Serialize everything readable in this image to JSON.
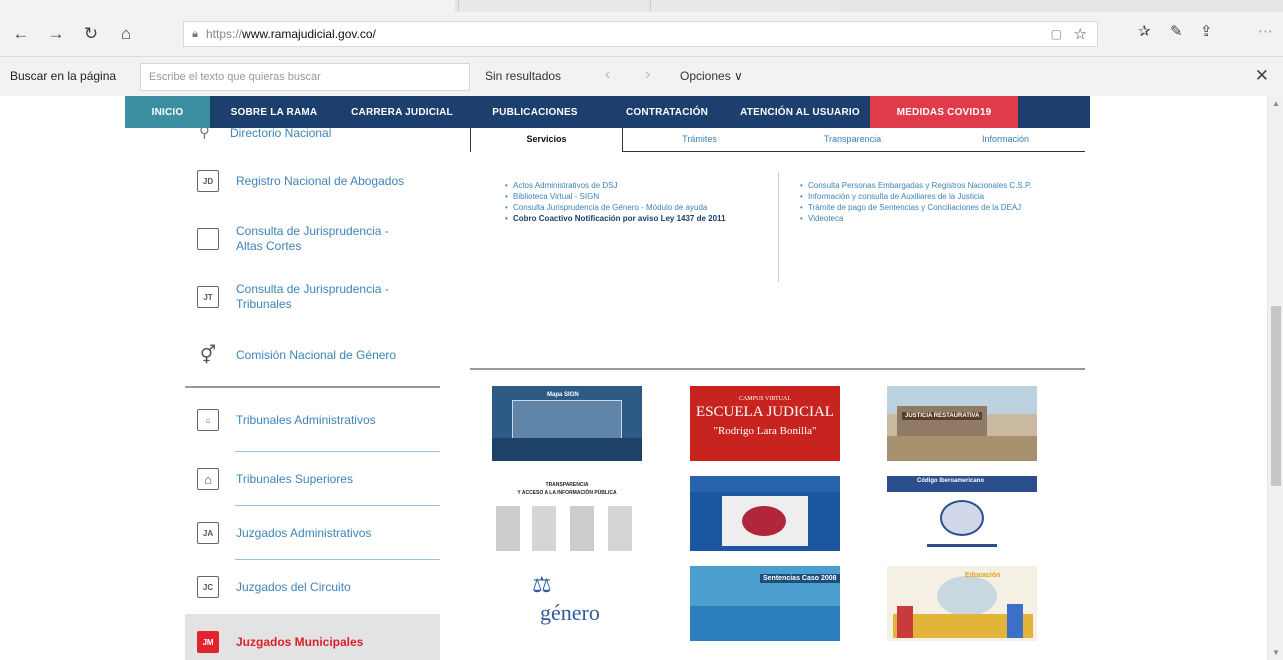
{
  "browser": {
    "url_proto": "https://",
    "url_host": "www.ramajudicial.gov.co/",
    "find_label": "Buscar en la página",
    "find_placeholder": "Escribe el texto que quieras buscar",
    "find_results": "Sin resultados",
    "find_options": "Opciones ∨"
  },
  "nav": {
    "items": [
      "INICIO",
      "SOBRE LA RAMA",
      "CARRERA JUDICIAL",
      "PUBLICACIONES",
      "CONTRATACIÓN",
      "ATENCIÓN AL USUARIO",
      "MEDIDAS COVID19"
    ]
  },
  "subtabs": [
    "Servicios",
    "Trámites",
    "Transparencia",
    "Información"
  ],
  "leftmenu": {
    "partial": "Directorio Nacional",
    "items": [
      {
        "label": "Registro Nacional de Abogados",
        "icon": "JD"
      },
      {
        "label": "Consulta de Jurisprudencia - Altas Cortes",
        "icon": ""
      },
      {
        "label": "Consulta de Jurisprudencia - Tribunales",
        "icon": "JT"
      },
      {
        "label": "Comisión Nacional de Género",
        "icon": ""
      }
    ],
    "items2": [
      {
        "label": "Tribunales Administrativos",
        "icon": ""
      },
      {
        "label": "Tribunales Superiores",
        "icon": ""
      },
      {
        "label": "Juzgados Administrativos",
        "icon": "JA"
      },
      {
        "label": "Juzgados del Circuito",
        "icon": "JC"
      },
      {
        "label": "Juzgados Municipales",
        "icon": "JM"
      }
    ]
  },
  "services": {
    "col1": [
      "Actos Administrativos de DSJ",
      "Biblioteca Virtual - SIGN",
      "Consulta Jurisprudencia de Género - Módulo de ayuda"
    ],
    "col1_bold": "Cobro Coactivo Notificación por aviso Ley 1437 de 2011",
    "col2": [
      "Consulta Personas Embargadas y Registros Nacionales C.S.P.",
      "Información y consulta de Auxiliares de la Justicia",
      "Trámite de pago de Sentencias y Conciliaciones de la DEAJ",
      "Videoteca"
    ]
  },
  "tiles": {
    "t1_text": "Mapa SIGN",
    "t2_top": "CAMPUS VIRTUAL",
    "t2_main": "ESCUELA JUDICIAL",
    "t2_sub": "\"Rodrigo Lara Bonilla\"",
    "t3_text": "JUSTICIA RESTAURATIVA",
    "t4_l1": "TRANSPARENCIA",
    "t4_l2": "Y ACCESO A LA INFORMACIÓN PÚBLICA",
    "t6_text": "Código Iberoamericano",
    "t7_text": "género",
    "t8_text": "Sentencias Caso 2008",
    "t9_text": "Educación"
  }
}
